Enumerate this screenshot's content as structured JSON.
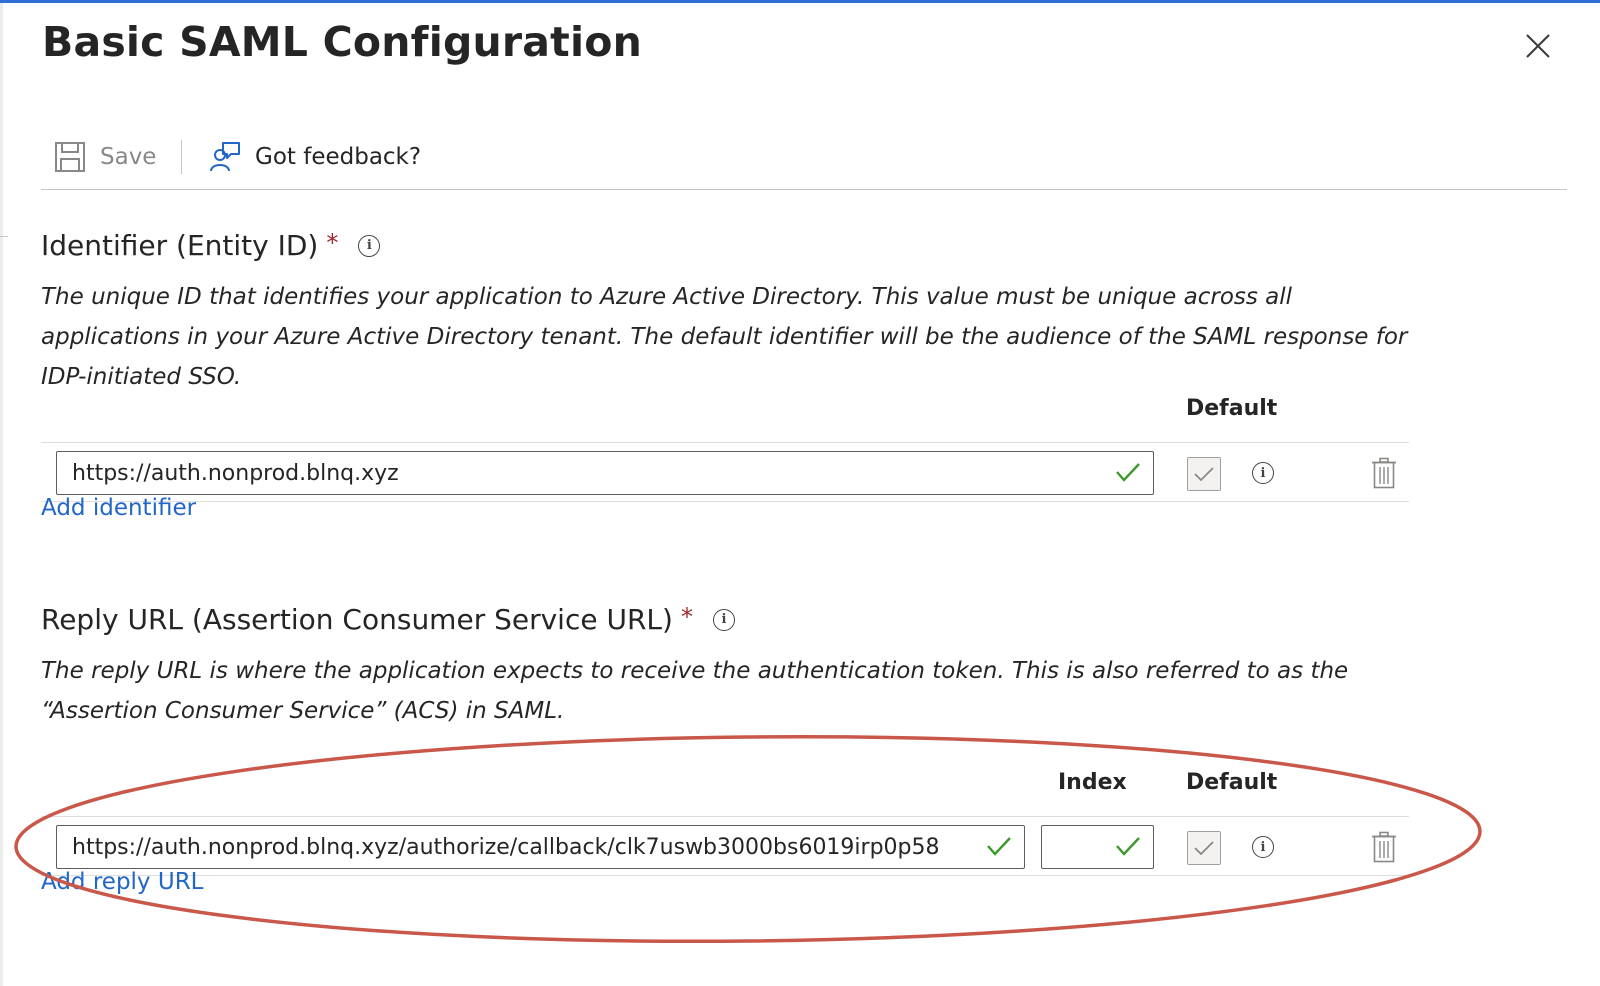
{
  "panel": {
    "title": "Basic SAML Configuration"
  },
  "toolbar": {
    "save_label": "Save",
    "feedback_label": "Got feedback?"
  },
  "identifier": {
    "title": "Identifier (Entity ID)",
    "required_mark": "*",
    "description": "The unique ID that identifies your application to Azure Active Directory. This value must be unique across all applications in your Azure Active Directory tenant. The default identifier will be the audience of the SAML response for IDP-initiated SSO.",
    "default_header": "Default",
    "rows": [
      {
        "value": "https://auth.nonprod.blnq.xyz",
        "default_checked": true
      }
    ],
    "add_label": "Add identifier"
  },
  "reply_url": {
    "title": "Reply URL (Assertion Consumer Service URL)",
    "required_mark": "*",
    "description": "The reply URL is where the application expects to receive the authentication token. This is also referred to as the “Assertion Consumer Service” (ACS) in SAML.",
    "index_header": "Index",
    "default_header": "Default",
    "rows": [
      {
        "value": "https://auth.nonprod.blnq.xyz/authorize/callback/clk7uswb3000bs6019irp0p58",
        "index": "",
        "default_checked": true
      }
    ],
    "add_label": "Add reply URL"
  },
  "colors": {
    "accent": "#2f6fd6",
    "link": "#2266c8",
    "valid_check": "#3a9a2a",
    "required": "#a4262c",
    "annotation": "#c9584b"
  },
  "icons": {
    "close": "close-icon",
    "save": "save-icon",
    "feedback": "feedback-icon",
    "info": "info-icon",
    "valid": "checkmark-icon",
    "delete": "trash-icon"
  }
}
